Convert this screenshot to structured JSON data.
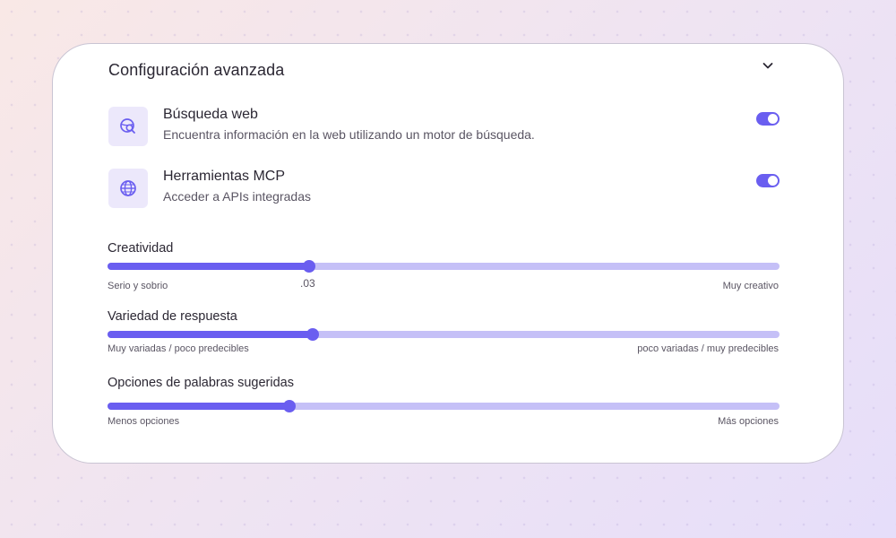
{
  "panel": {
    "title": "Configuración avanzada",
    "collapse_icon": "chevron-down-icon"
  },
  "tools": [
    {
      "icon": "web-search-icon",
      "name": "Búsqueda web",
      "description": "Encuentra información en la web utilizando un motor de búsqueda.",
      "enabled": true
    },
    {
      "icon": "globe-icon",
      "name": "Herramientas MCP",
      "description": "Acceder a APIs integradas",
      "enabled": true
    }
  ],
  "sliders": {
    "creativity": {
      "label": "Creatividad",
      "min_label": "Serio y sobrio",
      "max_label": "Muy creativo",
      "value_label": ".03",
      "value_fraction": 0.3
    },
    "variety": {
      "label": "Variedad de respuesta",
      "min_label": "Muy variadas / poco predecibles",
      "max_label": "poco variadas / muy predecibles",
      "value_fraction": 0.305
    },
    "word_options": {
      "label": "Opciones de palabras sugeridas",
      "min_label": "Menos opciones",
      "max_label": "Más opciones",
      "value_fraction": 0.27
    }
  },
  "colors": {
    "accent": "#6a5ef0",
    "track": "#c5c0f7",
    "icon_bg": "#ece8fb"
  }
}
